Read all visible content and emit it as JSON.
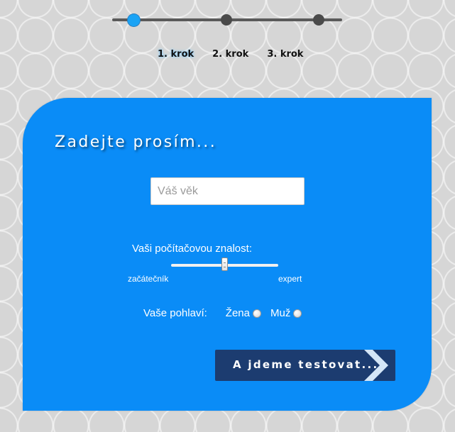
{
  "steps": {
    "current": 1,
    "labels": [
      "1. krok",
      "2. krok",
      "3. krok"
    ]
  },
  "form": {
    "title": "Zadejte prosím...",
    "age_placeholder": "Váš věk",
    "age_value": "",
    "knowledge": {
      "label": "Vaši počítačovou znalost:",
      "min_label": "začátečník",
      "max_label": "expert",
      "value_fraction": 0.5
    },
    "gender": {
      "label": "Vaše pohlaví:",
      "options": [
        "Žena",
        "Muž"
      ],
      "selected": null
    },
    "submit_label": "A jdeme testovat..."
  },
  "colors": {
    "card": "#0a8cf7",
    "button": "#1c3c70",
    "active_step": "#1aa3f5",
    "inactive_step": "#4a4a4a"
  },
  "icons": [
    "chevron-right-icon",
    "slider-handle",
    "radio"
  ]
}
